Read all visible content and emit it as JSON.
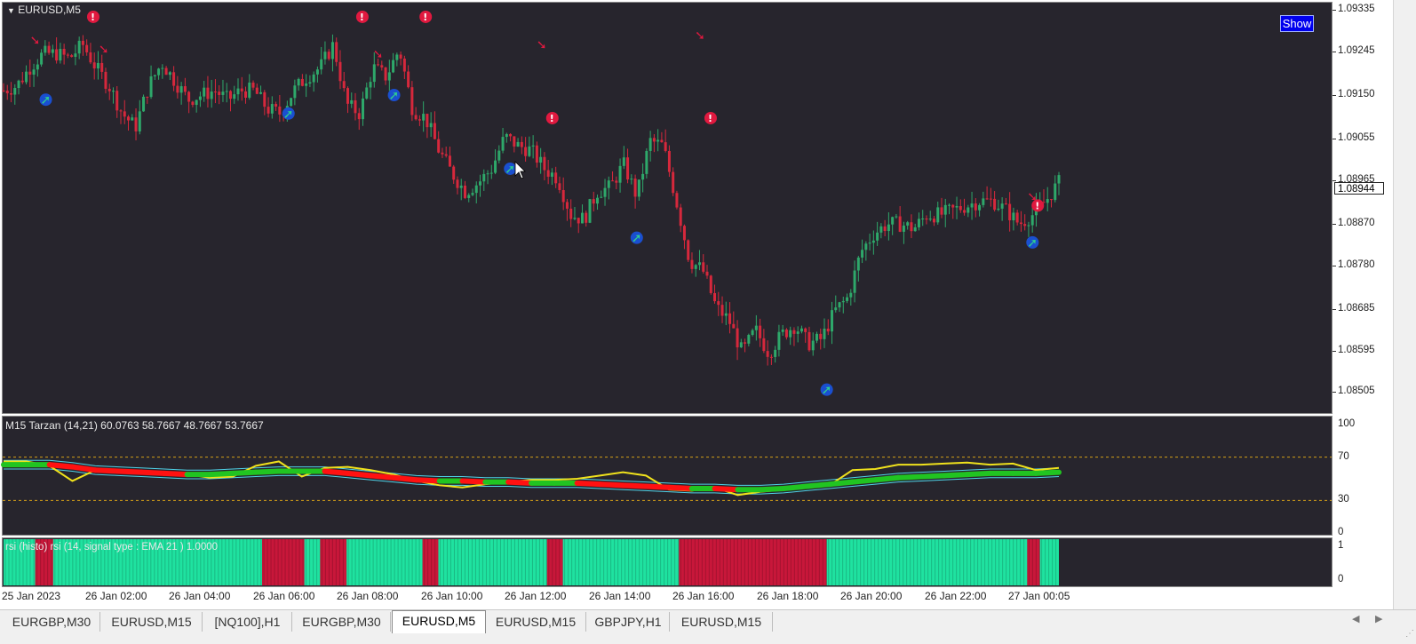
{
  "symbol_title": "EURUSD,M5",
  "show_button_label": "Show",
  "current_price": "1.08944",
  "price_scale": [
    "1.09335",
    "1.09245",
    "1.09150",
    "1.09055",
    "1.08965",
    "1.08870",
    "1.08780",
    "1.08685",
    "1.08595",
    "1.08505"
  ],
  "indicator1": {
    "label": "M15 Tarzan  (14,21) 60.0763 58.7667 48.7667 53.7667",
    "scale": [
      "100",
      "70",
      "30",
      "0"
    ],
    "colors": {
      "up": "#21c421",
      "down": "#ff1111",
      "rsi": "#f0e21c",
      "band": "#4fd3e8",
      "level": "#d4a017"
    }
  },
  "indicator2": {
    "label": "rsi (histo) rsi (14, signal type : EMA  21 ) 1.0000",
    "scale": [
      "1",
      "0"
    ],
    "colors": {
      "bull": "#1fe2a0",
      "bear": "#c8173a"
    }
  },
  "time_axis": [
    "25 Jan 2023",
    "26 Jan 02:00",
    "26 Jan 04:00",
    "26 Jan 06:00",
    "26 Jan 08:00",
    "26 Jan 10:00",
    "26 Jan 12:00",
    "26 Jan 14:00",
    "26 Jan 16:00",
    "26 Jan 18:00",
    "26 Jan 20:00",
    "26 Jan 22:00",
    "27 Jan 00:05"
  ],
  "tabs": [
    "EURGBP,M30",
    "EURUSD,M15",
    "[NQ100],H1",
    "EURGBP,M30",
    "EURUSD,M5",
    "EURUSD,M15",
    "GBPJPY,H1",
    "EURUSD,M15"
  ],
  "active_tab_index": 4,
  "colors": {
    "chart_bg": "#27252d",
    "bull_candle": "#2ea86a",
    "bear_candle": "#d6283c",
    "buy_arrow": "#2fcf8f",
    "sell_arrow": "#e0193f",
    "show_button": "#0000ee"
  },
  "chart_data": {
    "type": "candlestick",
    "price_path": [
      1.0916,
      1.0917,
      1.0921,
      1.0924,
      1.0924,
      1.0923,
      1.0926,
      1.0921,
      1.0917,
      1.0911,
      1.0908,
      1.0917,
      1.0922,
      1.0918,
      1.0914,
      1.0915,
      1.0916,
      1.0914,
      1.0916,
      1.0916,
      1.0912,
      1.0911,
      1.0916,
      1.0919,
      1.0921,
      1.0926,
      1.0913,
      1.0911,
      1.0921,
      1.0919,
      1.0925,
      1.0912,
      1.091,
      1.0903,
      1.0898,
      1.0894,
      1.0896,
      1.0899,
      1.0906,
      1.0904,
      1.0903,
      1.0899,
      1.0897,
      1.0889,
      1.0888,
      1.0894,
      1.0895,
      1.09,
      1.0893,
      1.0905,
      1.0904,
      1.0892,
      1.0879,
      1.0877,
      1.0869,
      1.0866,
      1.0859,
      1.0864,
      1.0859,
      1.0863,
      1.0865,
      1.0861,
      1.0862,
      1.0868,
      1.0871,
      1.0881,
      1.0885,
      1.0887,
      1.0887,
      1.0886,
      1.0889,
      1.0889,
      1.089,
      1.0891,
      1.0892,
      1.0892,
      1.089,
      1.0887,
      1.0889,
      1.0892,
      1.0896
    ],
    "ylim": [
      1.08465,
      1.09345
    ],
    "buy_signals": [
      [
        0.04,
        1.0914
      ],
      [
        0.27,
        1.0911
      ],
      [
        0.37,
        1.0915
      ],
      [
        0.48,
        1.0899
      ],
      [
        0.6,
        1.0884
      ],
      [
        0.78,
        1.0851
      ],
      [
        0.975,
        1.0883
      ]
    ],
    "sell_signals": [
      [
        0.03,
        1.0927
      ],
      [
        0.085,
        1.0932
      ],
      [
        0.095,
        1.0925
      ],
      [
        0.34,
        1.0932
      ],
      [
        0.355,
        1.0924
      ],
      [
        0.4,
        1.0932
      ],
      [
        0.51,
        1.0926
      ],
      [
        0.52,
        1.091
      ],
      [
        0.66,
        1.0928
      ],
      [
        0.67,
        1.091
      ],
      [
        0.975,
        1.0893
      ],
      [
        0.98,
        1.0891
      ]
    ],
    "tarzan_rsi": [
      66,
      66,
      62,
      48,
      58,
      57,
      57,
      56,
      54,
      51,
      52,
      62,
      66,
      52,
      60,
      61,
      58,
      54,
      48,
      44,
      42,
      45,
      47,
      49,
      49,
      50,
      53,
      56,
      53,
      40,
      39,
      42,
      35,
      38,
      40,
      42,
      44,
      58,
      59,
      63,
      63,
      64,
      65,
      63,
      64,
      58,
      60
    ],
    "tarzan_ma": [
      63,
      63,
      63,
      61,
      58,
      57,
      56,
      55,
      54,
      54,
      55,
      56,
      57,
      57,
      57,
      55,
      53,
      51,
      49,
      48,
      48,
      47,
      47,
      46,
      46,
      46,
      45,
      44,
      43,
      42,
      41,
      41,
      40,
      40,
      41,
      43,
      45,
      47,
      49,
      51,
      52,
      53,
      54,
      55,
      55,
      55,
      56
    ],
    "histo_state": [
      1,
      0,
      1,
      0,
      1,
      0,
      1,
      0,
      1,
      0,
      1,
      0,
      1,
      0,
      1
    ],
    "histo_breaks": [
      0.0,
      0.03,
      0.047,
      0.245,
      0.285,
      0.3,
      0.325,
      0.397,
      0.412,
      0.515,
      0.53,
      0.64,
      0.78,
      0.97,
      0.982
    ]
  }
}
